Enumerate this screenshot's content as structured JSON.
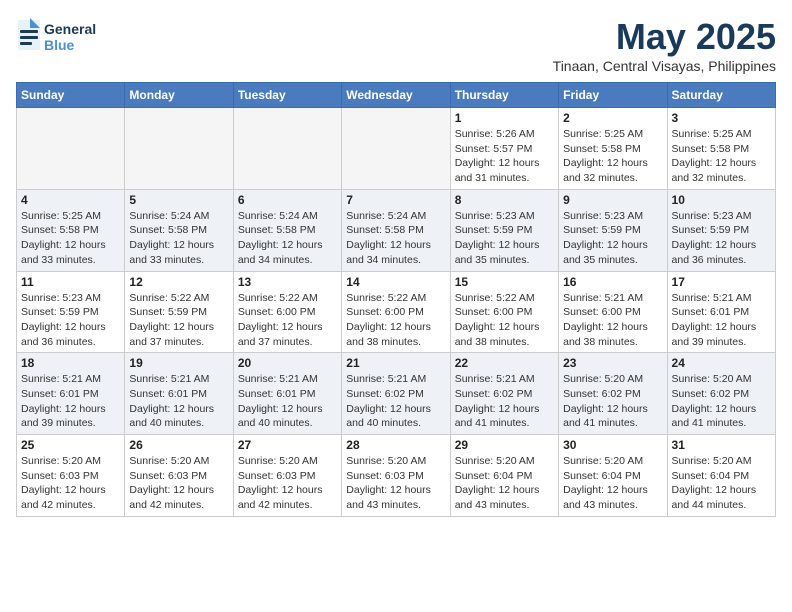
{
  "logo": {
    "line1": "General",
    "line2": "Blue"
  },
  "title": {
    "month_year": "May 2025",
    "location": "Tinaan, Central Visayas, Philippines"
  },
  "weekdays": [
    "Sunday",
    "Monday",
    "Tuesday",
    "Wednesday",
    "Thursday",
    "Friday",
    "Saturday"
  ],
  "weeks": [
    [
      {
        "day": "",
        "info": ""
      },
      {
        "day": "",
        "info": ""
      },
      {
        "day": "",
        "info": ""
      },
      {
        "day": "",
        "info": ""
      },
      {
        "day": "1",
        "info": "Sunrise: 5:26 AM\nSunset: 5:57 PM\nDaylight: 12 hours\nand 31 minutes."
      },
      {
        "day": "2",
        "info": "Sunrise: 5:25 AM\nSunset: 5:58 PM\nDaylight: 12 hours\nand 32 minutes."
      },
      {
        "day": "3",
        "info": "Sunrise: 5:25 AM\nSunset: 5:58 PM\nDaylight: 12 hours\nand 32 minutes."
      }
    ],
    [
      {
        "day": "4",
        "info": "Sunrise: 5:25 AM\nSunset: 5:58 PM\nDaylight: 12 hours\nand 33 minutes."
      },
      {
        "day": "5",
        "info": "Sunrise: 5:24 AM\nSunset: 5:58 PM\nDaylight: 12 hours\nand 33 minutes."
      },
      {
        "day": "6",
        "info": "Sunrise: 5:24 AM\nSunset: 5:58 PM\nDaylight: 12 hours\nand 34 minutes."
      },
      {
        "day": "7",
        "info": "Sunrise: 5:24 AM\nSunset: 5:58 PM\nDaylight: 12 hours\nand 34 minutes."
      },
      {
        "day": "8",
        "info": "Sunrise: 5:23 AM\nSunset: 5:59 PM\nDaylight: 12 hours\nand 35 minutes."
      },
      {
        "day": "9",
        "info": "Sunrise: 5:23 AM\nSunset: 5:59 PM\nDaylight: 12 hours\nand 35 minutes."
      },
      {
        "day": "10",
        "info": "Sunrise: 5:23 AM\nSunset: 5:59 PM\nDaylight: 12 hours\nand 36 minutes."
      }
    ],
    [
      {
        "day": "11",
        "info": "Sunrise: 5:23 AM\nSunset: 5:59 PM\nDaylight: 12 hours\nand 36 minutes."
      },
      {
        "day": "12",
        "info": "Sunrise: 5:22 AM\nSunset: 5:59 PM\nDaylight: 12 hours\nand 37 minutes."
      },
      {
        "day": "13",
        "info": "Sunrise: 5:22 AM\nSunset: 6:00 PM\nDaylight: 12 hours\nand 37 minutes."
      },
      {
        "day": "14",
        "info": "Sunrise: 5:22 AM\nSunset: 6:00 PM\nDaylight: 12 hours\nand 38 minutes."
      },
      {
        "day": "15",
        "info": "Sunrise: 5:22 AM\nSunset: 6:00 PM\nDaylight: 12 hours\nand 38 minutes."
      },
      {
        "day": "16",
        "info": "Sunrise: 5:21 AM\nSunset: 6:00 PM\nDaylight: 12 hours\nand 38 minutes."
      },
      {
        "day": "17",
        "info": "Sunrise: 5:21 AM\nSunset: 6:01 PM\nDaylight: 12 hours\nand 39 minutes."
      }
    ],
    [
      {
        "day": "18",
        "info": "Sunrise: 5:21 AM\nSunset: 6:01 PM\nDaylight: 12 hours\nand 39 minutes."
      },
      {
        "day": "19",
        "info": "Sunrise: 5:21 AM\nSunset: 6:01 PM\nDaylight: 12 hours\nand 40 minutes."
      },
      {
        "day": "20",
        "info": "Sunrise: 5:21 AM\nSunset: 6:01 PM\nDaylight: 12 hours\nand 40 minutes."
      },
      {
        "day": "21",
        "info": "Sunrise: 5:21 AM\nSunset: 6:02 PM\nDaylight: 12 hours\nand 40 minutes."
      },
      {
        "day": "22",
        "info": "Sunrise: 5:21 AM\nSunset: 6:02 PM\nDaylight: 12 hours\nand 41 minutes."
      },
      {
        "day": "23",
        "info": "Sunrise: 5:20 AM\nSunset: 6:02 PM\nDaylight: 12 hours\nand 41 minutes."
      },
      {
        "day": "24",
        "info": "Sunrise: 5:20 AM\nSunset: 6:02 PM\nDaylight: 12 hours\nand 41 minutes."
      }
    ],
    [
      {
        "day": "25",
        "info": "Sunrise: 5:20 AM\nSunset: 6:03 PM\nDaylight: 12 hours\nand 42 minutes."
      },
      {
        "day": "26",
        "info": "Sunrise: 5:20 AM\nSunset: 6:03 PM\nDaylight: 12 hours\nand 42 minutes."
      },
      {
        "day": "27",
        "info": "Sunrise: 5:20 AM\nSunset: 6:03 PM\nDaylight: 12 hours\nand 42 minutes."
      },
      {
        "day": "28",
        "info": "Sunrise: 5:20 AM\nSunset: 6:03 PM\nDaylight: 12 hours\nand 43 minutes."
      },
      {
        "day": "29",
        "info": "Sunrise: 5:20 AM\nSunset: 6:04 PM\nDaylight: 12 hours\nand 43 minutes."
      },
      {
        "day": "30",
        "info": "Sunrise: 5:20 AM\nSunset: 6:04 PM\nDaylight: 12 hours\nand 43 minutes."
      },
      {
        "day": "31",
        "info": "Sunrise: 5:20 AM\nSunset: 6:04 PM\nDaylight: 12 hours\nand 44 minutes."
      }
    ]
  ]
}
